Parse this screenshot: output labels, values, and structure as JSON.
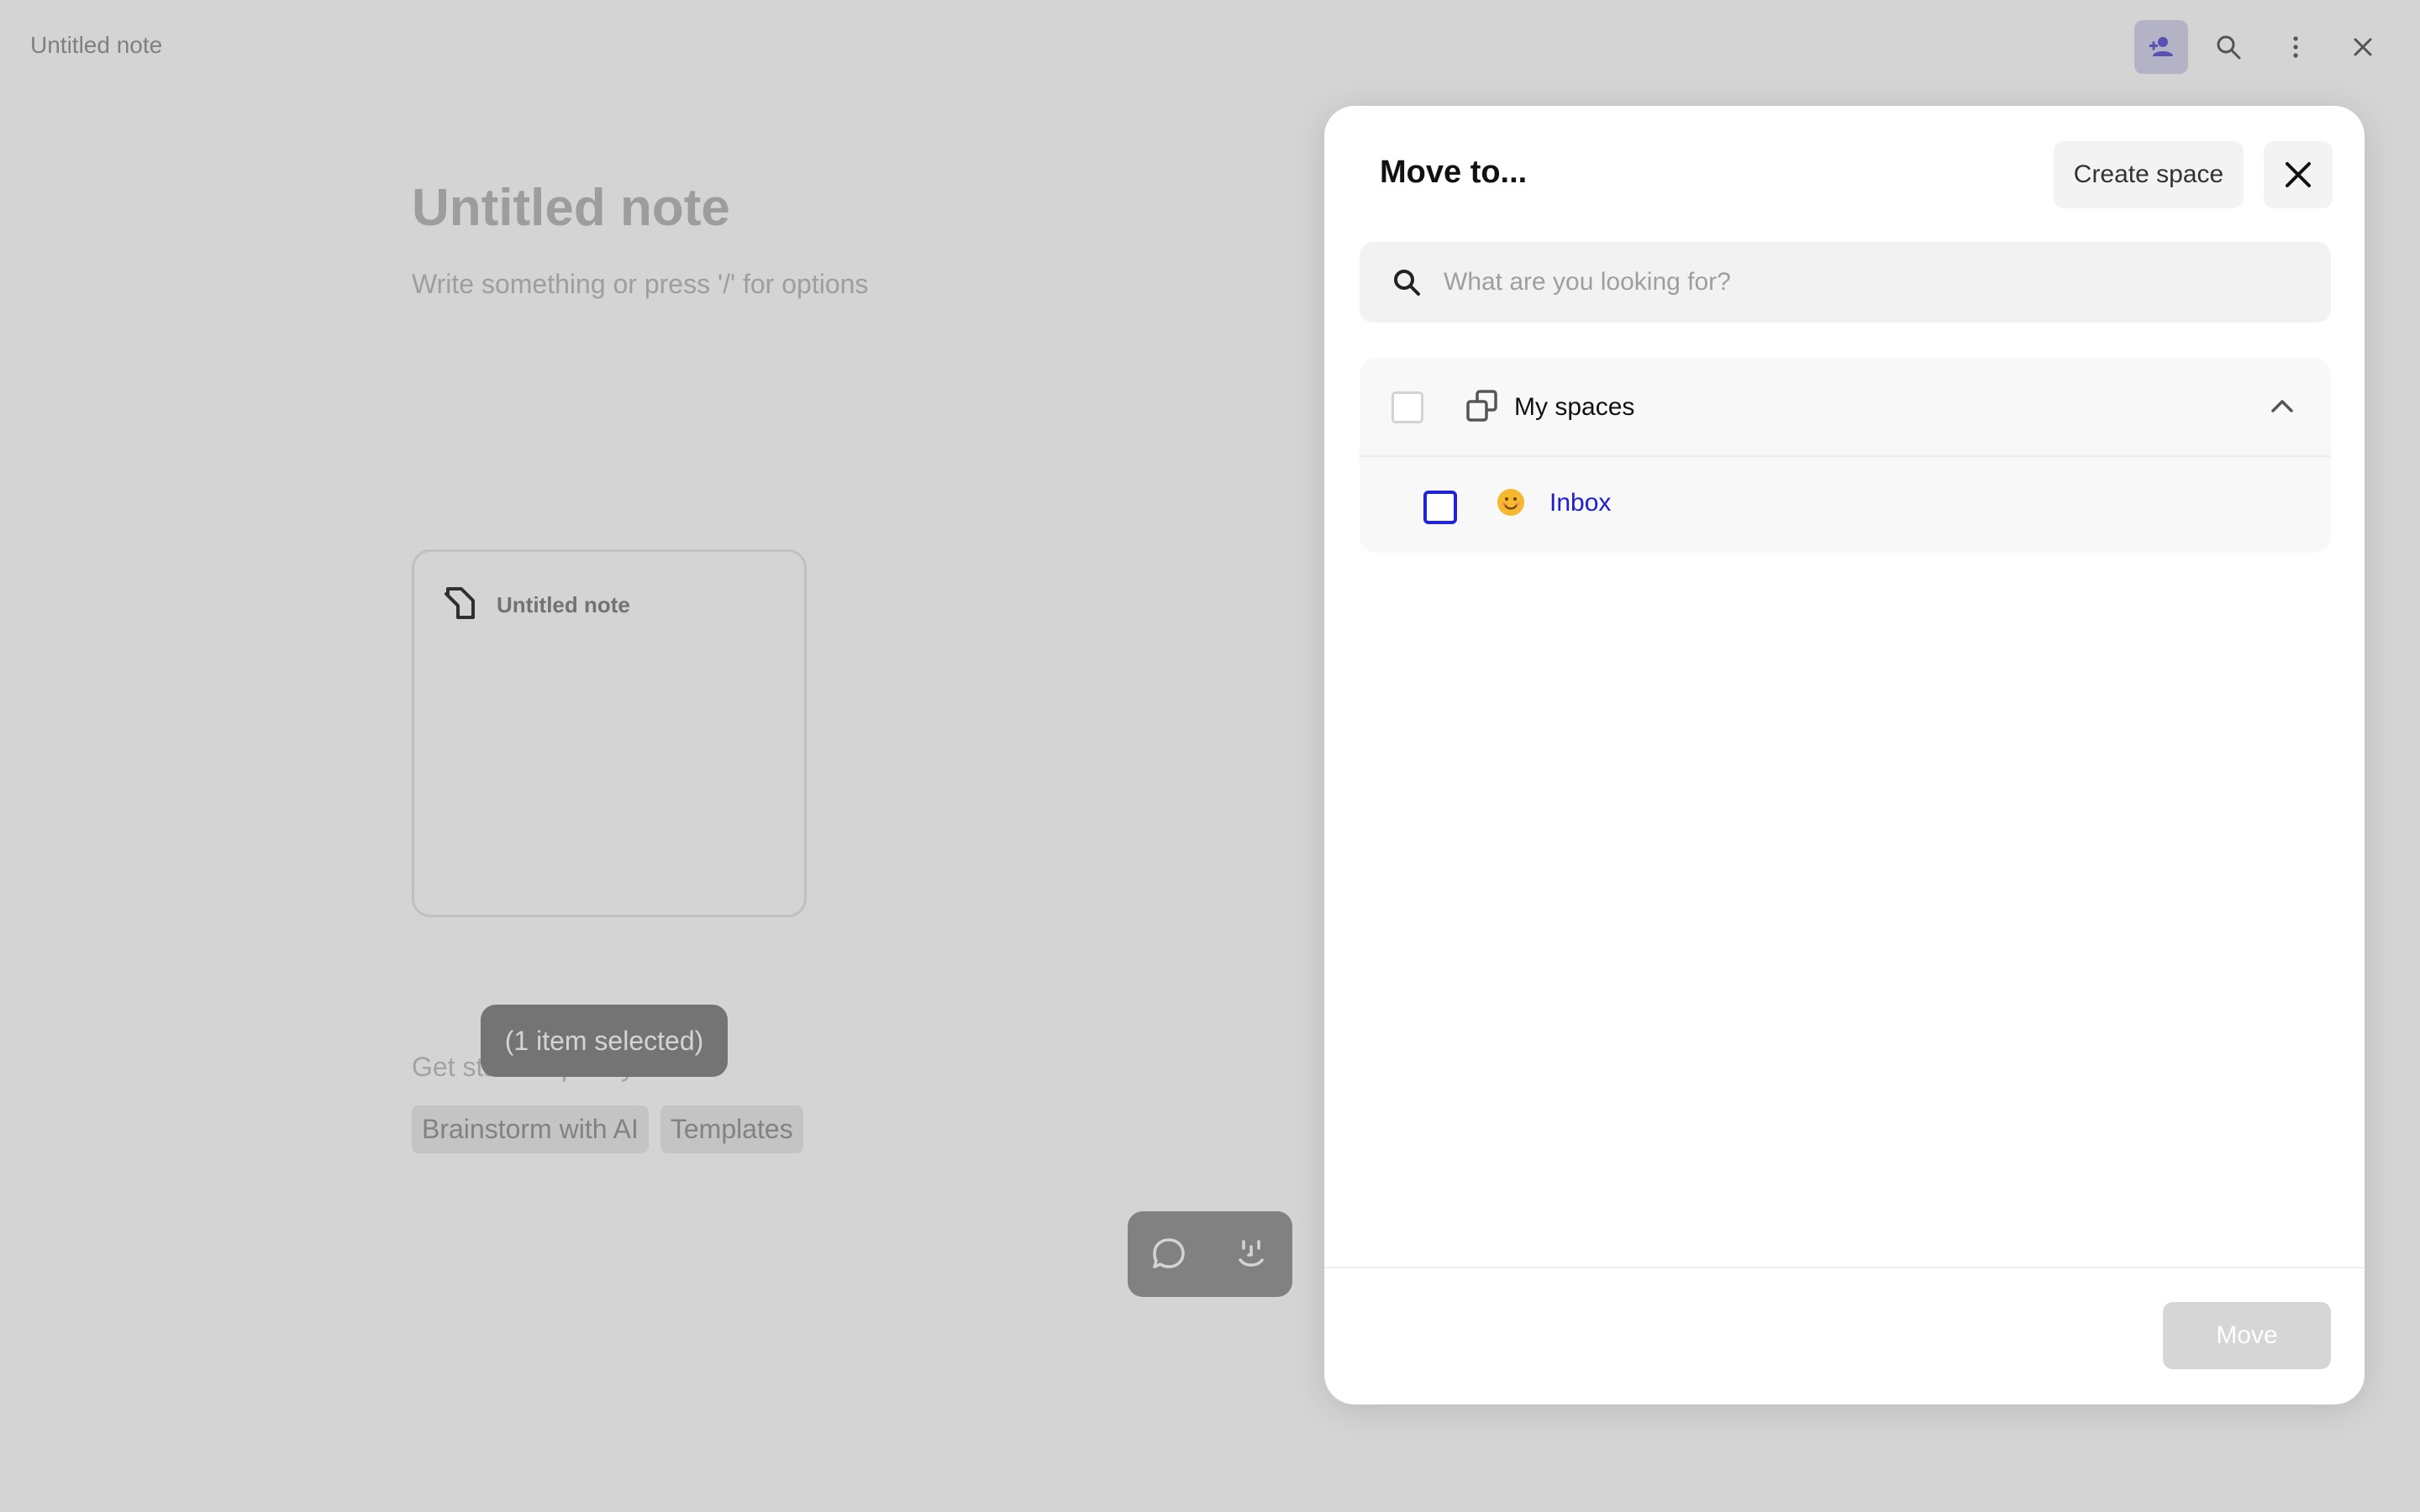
{
  "app": {
    "window_title": "Untitled note"
  },
  "toolbar": {
    "share_icon": "add-person-icon",
    "search_icon": "search-icon",
    "more_icon": "more-vertical-icon",
    "close_icon": "close-icon"
  },
  "note": {
    "title": "Untitled note",
    "placeholder": "Write something or press '/' for options",
    "card_title": "Untitled note",
    "quick_heading": "Get started quickly",
    "quick_actions": [
      "Brainstorm with AI",
      "Templates"
    ],
    "selection_badge": "(1 item selected)"
  },
  "dialog": {
    "title": "Move to...",
    "create_space_label": "Create space",
    "search_placeholder": "What are you looking for?",
    "group_label": "My spaces",
    "items": [
      {
        "label": "Inbox",
        "emoji": "😊"
      }
    ],
    "move_label": "Move"
  },
  "colors": {
    "accent": "#2323d8",
    "share_button_bg": "#d9d8ee",
    "disabled_button": "#d6d6d6"
  }
}
